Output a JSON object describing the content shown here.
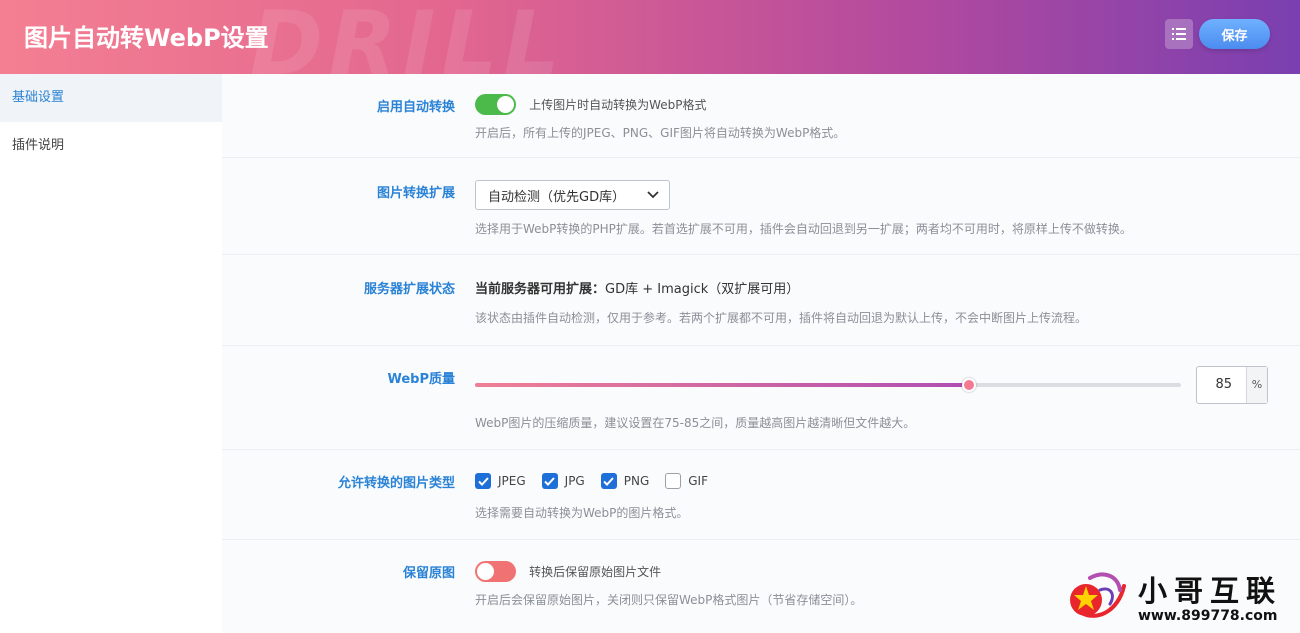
{
  "header": {
    "title": "图片自动转WebP设置",
    "watermark": "DRILL",
    "save_label": "保存"
  },
  "sidebar": {
    "items": [
      {
        "label": "基础设置",
        "active": true
      },
      {
        "label": "插件说明",
        "active": false
      }
    ]
  },
  "settings": {
    "enable": {
      "label": "启用自动转换",
      "toggle_text": "上传图片时自动转换为WebP格式",
      "on": true,
      "desc": "开启后，所有上传的JPEG、PNG、GIF图片将自动转换为WebP格式。"
    },
    "extension": {
      "label": "图片转换扩展",
      "selected": "自动检测（优先GD库）",
      "desc": "选择用于WebP转换的PHP扩展。若首选扩展不可用，插件会自动回退到另一扩展；两者均不可用时，将原样上传不做转换。"
    },
    "server_status": {
      "label": "服务器扩展状态",
      "prefix": "当前服务器可用扩展：",
      "value": "GD库 + Imagick（双扩展可用）",
      "desc": "该状态由插件自动检测，仅用于参考。若两个扩展都不可用，插件将自动回退为默认上传，不会中断图片上传流程。"
    },
    "quality": {
      "label": "WebP质量",
      "value": "85",
      "fraction": 0.7,
      "unit": "%",
      "desc": "WebP图片的压缩质量，建议设置在75-85之间，质量越高图片越清晰但文件越大。"
    },
    "types": {
      "label": "允许转换的图片类型",
      "options": [
        {
          "label": "JPEG",
          "checked": true
        },
        {
          "label": "JPG",
          "checked": true
        },
        {
          "label": "PNG",
          "checked": true
        },
        {
          "label": "GIF",
          "checked": false
        }
      ],
      "desc": "选择需要自动转换为WebP的图片格式。"
    },
    "keep_original": {
      "label": "保留原图",
      "toggle_text": "转换后保留原始图片文件",
      "on": false,
      "desc": "开启后会保留原始图片，关闭则只保留WebP格式图片（节省存储空间）。"
    }
  },
  "logo": {
    "name": "小哥互联",
    "url": "www.899778.com"
  }
}
